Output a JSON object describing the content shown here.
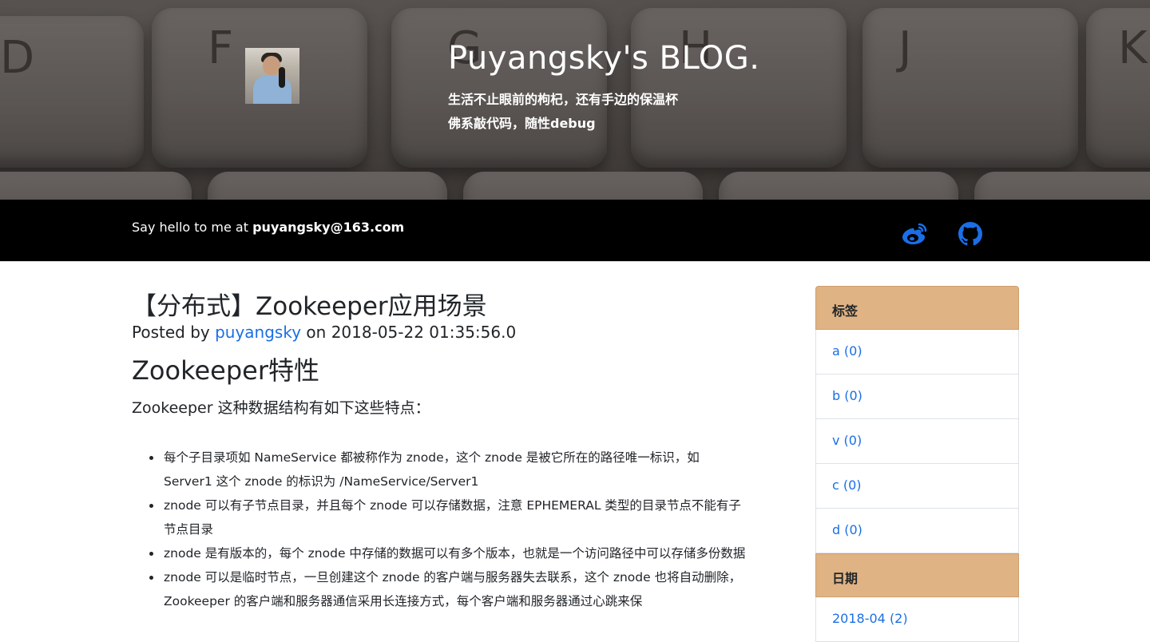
{
  "header": {
    "title": "Puyangsky's BLOG.",
    "subtitle_line1": "生活不止眼前的枸杞，还有手边的保温杯",
    "subtitle_line2": "佛系敲代码，随性debug"
  },
  "topbar": {
    "hello_prefix": "Say hello to me at ",
    "email": "puyangsky@163.com",
    "icons": [
      "weibo-icon",
      "github-icon"
    ],
    "icon_color": "#1a6fe6"
  },
  "post": {
    "title": "【分布式】Zookeeper应用场景",
    "meta_prefix": "Posted by ",
    "author": "puyangsky",
    "meta_on": " on ",
    "date": "2018-05-22 01:35:56.0",
    "section_title": "Zookeeper特性",
    "intro": "Zookeeper 这种数据结构有如下这些特点：",
    "bullets": [
      "每个子目录项如 NameService 都被称作为 znode，这个 znode 是被它所在的路径唯一标识，如 Server1 这个 znode 的标识为 /NameService/Server1",
      "znode 可以有子节点目录，并且每个 znode 可以存储数据，注意 EPHEMERAL 类型的目录节点不能有子节点目录",
      "znode 是有版本的，每个 znode 中存储的数据可以有多个版本，也就是一个访问路径中可以存储多份数据",
      "znode 可以是临时节点，一旦创建这个 znode 的客户端与服务器失去联系，这个 znode 也将自动删除，Zookeeper 的客户端和服务器通信采用长连接方式，每个客户端和服务器通过心跳来保"
    ]
  },
  "sidebar": {
    "tags_heading": "标签",
    "tags": [
      "a (0)",
      "b (0)",
      "v (0)",
      "c (0)",
      "d (0)"
    ],
    "dates_heading": "日期",
    "dates": [
      "2018-04 (2)"
    ],
    "heading_color": "#dfb383"
  },
  "banner_keys": [
    "D",
    "F",
    "G",
    "H",
    "J",
    "K"
  ]
}
